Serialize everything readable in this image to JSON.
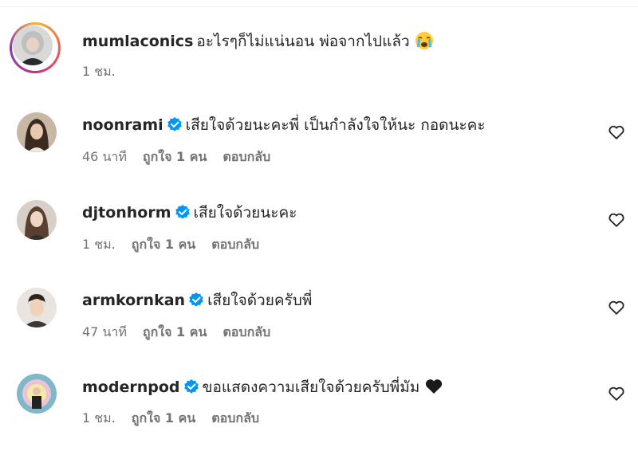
{
  "comments": [
    {
      "username": "mumlaconics",
      "verified": false,
      "text": "อะไรๆก็ไม่แน่นอน พ่อจากไปแล้ว",
      "emoji": "crying-face",
      "time": "1 ชม.",
      "likes": "",
      "reply": ""
    },
    {
      "username": "noonrami",
      "verified": true,
      "text": "เสียใจด้วยนะคะพี่ เป็นกำลังใจให้นะ กอดนะคะ",
      "time": "46 นาที",
      "likes": "ถูกใจ 1 คน",
      "reply": "ตอบกลับ"
    },
    {
      "username": "djtonhorm",
      "verified": true,
      "text": "เสียใจด้วยนะคะ",
      "time": "1 ชม.",
      "likes": "ถูกใจ 1 คน",
      "reply": "ตอบกลับ"
    },
    {
      "username": "armkornkan",
      "verified": true,
      "text": "เสียใจด้วยครับพี่",
      "time": "47 นาที",
      "likes": "ถูกใจ 1 คน",
      "reply": "ตอบกลับ"
    },
    {
      "username": "modernpod",
      "verified": true,
      "text": "ขอแสดงความเสียใจด้วยครับพี่มัม",
      "emoji": "black-heart",
      "time": "1 ชม.",
      "likes": "ถูกใจ 1 คน",
      "reply": "ตอบกลับ"
    }
  ],
  "icons": {
    "verified": "verified-badge-icon",
    "like": "heart-outline-icon"
  },
  "colors": {
    "verified": "#0095f6",
    "secondary_text": "#737373",
    "primary_text": "#262626"
  }
}
